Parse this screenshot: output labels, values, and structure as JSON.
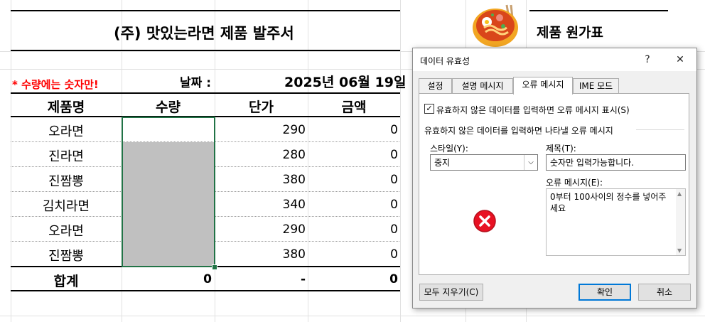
{
  "sheet": {
    "order_title": "(주) 맛있는라면 제품 발주서",
    "price_title": "제품 원가표",
    "warning": "* 수량에는 숫자만!",
    "date_label": "날짜 :",
    "date_value": "2025년 06월 19일",
    "headers": [
      "제품명",
      "수량",
      "단가",
      "금액"
    ],
    "rows": [
      {
        "name": "오라면",
        "qty": "",
        "price": "290",
        "amount": "0"
      },
      {
        "name": "진라면",
        "qty": "",
        "price": "280",
        "amount": "0"
      },
      {
        "name": "진짬뽕",
        "qty": "",
        "price": "380",
        "amount": "0"
      },
      {
        "name": "김치라면",
        "qty": "",
        "price": "340",
        "amount": "0"
      },
      {
        "name": "오라면",
        "qty": "",
        "price": "290",
        "amount": "0"
      },
      {
        "name": "진짬뽕",
        "qty": "",
        "price": "380",
        "amount": "0"
      }
    ],
    "total": {
      "label": "합계",
      "qty": "0",
      "price": "-",
      "amount": "0"
    }
  },
  "dialog": {
    "title": "데이터 유효성",
    "help": "?",
    "close": "✕",
    "tabs": [
      "설정",
      "설명 메시지",
      "오류 메시지",
      "IME 모드"
    ],
    "active_tab": "오류 메시지",
    "show_error_checkbox": "유효하지 않은 데이터를 입력하면 오류 메시지 표시(S)",
    "show_error_checked": true,
    "group_label": "유효하지 않은 데이터를 입력하면 나타낼 오류 메시지",
    "style_label": "스타일(Y):",
    "style_value": "중지",
    "title_label": "제목(T):",
    "title_value": "숫자만 입력가능합니다.",
    "message_label": "오류 메시지(E):",
    "message_value": "0부터 100사이의 정수를 넣어주세요",
    "clear_all": "모두 지우기(C)",
    "ok": "확인",
    "cancel": "취소"
  },
  "colors": {
    "selection": "#217346",
    "warning": "#ff0000",
    "stop_icon": "#e81123",
    "focus": "#0078d7"
  }
}
